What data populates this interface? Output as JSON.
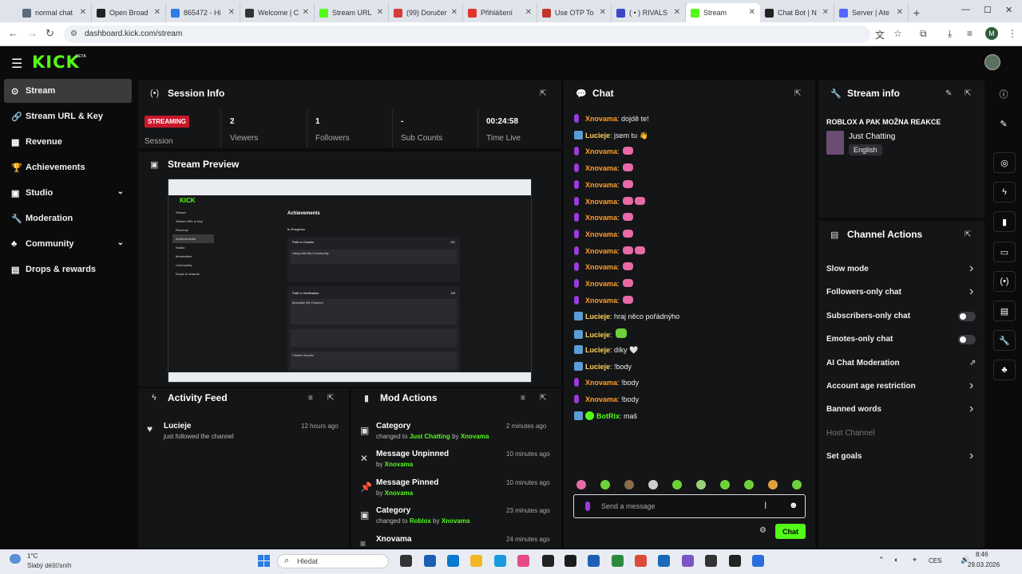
{
  "browser": {
    "tabs": [
      {
        "label": "normal chat",
        "color": "#5b6b7b"
      },
      {
        "label": "Open Broad",
        "color": "#222222"
      },
      {
        "label": "865472 - Hi",
        "color": "#2f7be8"
      },
      {
        "label": "Welcome | C",
        "color": "#333333"
      },
      {
        "label": "Stream URL",
        "color": "#53fc18"
      },
      {
        "label": "(99) Doručer",
        "color": "#d63a3a"
      },
      {
        "label": "Přihlášení",
        "color": "#e0342b"
      },
      {
        "label": "Use OTP To",
        "color": "#c0392b"
      },
      {
        "label": "( • ) RIVALS",
        "color": "#3a48c8"
      },
      {
        "label": "Stream",
        "color": "#53fc18",
        "active": true
      },
      {
        "label": "Chat Bot | N",
        "color": "#222222"
      },
      {
        "label": "Server | Ate",
        "color": "#5468ff"
      }
    ],
    "new_tab": "+",
    "url": "dashboard.kick.com/stream",
    "profile_initial": "M"
  },
  "header": {
    "logo": "KICK",
    "beta": "BETA"
  },
  "sidebar": {
    "items": [
      {
        "label": "Stream",
        "icon": "⊙",
        "active": true
      },
      {
        "label": "Stream URL & Key",
        "icon": "🔗"
      },
      {
        "label": "Revenue",
        "icon": "▦"
      },
      {
        "label": "Achievements",
        "icon": "🏆"
      },
      {
        "label": "Studio",
        "icon": "▣",
        "chevron": "⌄"
      },
      {
        "label": "Moderation",
        "icon": "🔧"
      },
      {
        "label": "Community",
        "icon": "♣",
        "chevron": "⌄"
      },
      {
        "label": "Drops & rewards",
        "icon": "▤"
      }
    ]
  },
  "session": {
    "title": "Session Info",
    "status_badge": "STREAMING",
    "session_label": "Session",
    "stats": [
      {
        "value": "2",
        "label": "Viewers"
      },
      {
        "value": "1",
        "label": "Followers"
      },
      {
        "value": "-",
        "label": "Sub Counts"
      },
      {
        "value": "00:24:58",
        "label": "Time Live"
      }
    ]
  },
  "preview": {
    "title": "Stream Preview",
    "inner_logo": "KICK",
    "inner_heading": "Achievements",
    "inner_section": "In Progress",
    "inner_items": [
      "Path to Creator",
      "Hang with My Community",
      "Path to Verification",
      "Moonlike My Channel",
      "Chatter Boosts"
    ],
    "inner_counts": [
      "0/1",
      "1/5"
    ],
    "inner_menu": [
      "Stream",
      "Stream URL & Key",
      "Revenue",
      "Achievements",
      "Studio",
      "Moderation",
      "Community",
      "Drops & rewards"
    ]
  },
  "activity": {
    "title": "Activity Feed",
    "items": [
      {
        "user": "Lucieje",
        "text": "just followed the channel",
        "time": "12 hours ago"
      }
    ]
  },
  "mod": {
    "title": "Mod Actions",
    "items": [
      {
        "title": "Category",
        "prefix": "changed to ",
        "target": "Just Chatting",
        "by": " by ",
        "user": "Xnovama",
        "time": "2 minutes ago",
        "icon": "▣"
      },
      {
        "title": "Message Unpinned",
        "prefix": "",
        "target": "",
        "by": "by ",
        "user": "Xnovama",
        "time": "10 minutes ago",
        "icon": "✕"
      },
      {
        "title": "Message Pinned",
        "prefix": "",
        "target": "",
        "by": "by ",
        "user": "Xnovama",
        "time": "10 minutes ago",
        "icon": "📌"
      },
      {
        "title": "Category",
        "prefix": "changed to ",
        "target": "Roblox",
        "by": " by ",
        "user": "Xnovama",
        "time": "23 minutes ago",
        "icon": "▣"
      },
      {
        "title": "Xnovama",
        "prefix": "",
        "target": "",
        "by": "",
        "user": "",
        "time": "24 minutes ago",
        "icon": "≡"
      }
    ]
  },
  "chat": {
    "title": "Chat",
    "messages": [
      {
        "user": "Xnovama",
        "color": "#ff9d2e",
        "text": "dojdě te!",
        "emotes": 0
      },
      {
        "user": "Lucieje",
        "color": "#ffd257",
        "text": "jsem tu 👋",
        "emotes": 0
      },
      {
        "user": "Xnovama",
        "color": "#ff9d2e",
        "text": "",
        "emotes": 1
      },
      {
        "user": "Xnovama",
        "color": "#ff9d2e",
        "text": "",
        "emotes": 1
      },
      {
        "user": "Xnovama",
        "color": "#ff9d2e",
        "text": "",
        "emotes": 1
      },
      {
        "user": "Xnovama",
        "color": "#ff9d2e",
        "text": "",
        "emotes": 2
      },
      {
        "user": "Xnovama",
        "color": "#ff9d2e",
        "text": "",
        "emotes": 1
      },
      {
        "user": "Xnovama",
        "color": "#ff9d2e",
        "text": "",
        "emotes": 1
      },
      {
        "user": "Xnovama",
        "color": "#ff9d2e",
        "text": "",
        "emotes": 2
      },
      {
        "user": "Xnovama",
        "color": "#ff9d2e",
        "text": "",
        "emotes": 1
      },
      {
        "user": "Xnovama",
        "color": "#ff9d2e",
        "text": "",
        "emotes": 1
      },
      {
        "user": "Xnovama",
        "color": "#ff9d2e",
        "text": "",
        "emotes": 1
      },
      {
        "user": "Lucieje",
        "color": "#ffd257",
        "text": "hraj něco pořádnýho",
        "emotes": 0
      },
      {
        "user": "Lucieje",
        "color": "#ffd257",
        "text": "",
        "emotes": 1,
        "green": true
      },
      {
        "user": "Lucieje",
        "color": "#ffd257",
        "text": "díky 🤍",
        "emotes": 0
      },
      {
        "user": "Lucieje",
        "color": "#ffd257",
        "text": "!body",
        "emotes": 0
      },
      {
        "user": "Xnovama",
        "color": "#ff9d2e",
        "text": "!body",
        "emotes": 0
      },
      {
        "user": "Xnovama",
        "color": "#ff9d2e",
        "text": "!body",
        "emotes": 0
      },
      {
        "user": "BotRix",
        "color": "#53fc18",
        "text": "maš",
        "emotes": 0
      }
    ],
    "input_placeholder": "Send a message",
    "send_label": "Chat",
    "emote_colors": [
      "#e76aa6",
      "#6fd13a",
      "#8a6d4a",
      "#cccccc",
      "#6fd13a",
      "#9ad17a",
      "#6fd13a",
      "#6fd13a",
      "#e0a040",
      "#6fd13a"
    ]
  },
  "stream_info": {
    "title": "Stream info",
    "stream_title": "ROBLOX A PAK MOŽNA REAKCE",
    "category": "Just Chatting",
    "language": "English"
  },
  "channel_actions": {
    "title": "Channel Actions",
    "items": [
      {
        "label": "Slow mode",
        "control": "chevron"
      },
      {
        "label": "Followers-only chat",
        "control": "chevron"
      },
      {
        "label": "Subscribers-only chat",
        "control": "toggle"
      },
      {
        "label": "Emotes-only chat",
        "control": "toggle"
      },
      {
        "label": "AI Chat Moderation",
        "control": "external"
      },
      {
        "label": "Account age restriction",
        "control": "chevron"
      },
      {
        "label": "Banned words",
        "control": "chevron"
      },
      {
        "label": "Host Channel",
        "control": "none",
        "disabled": true
      },
      {
        "label": "Set goals",
        "control": "chevron"
      }
    ]
  },
  "taskbar": {
    "weather": "1°C",
    "weather_desc": "Slabý déšť/sníh",
    "search_placeholder": "Hledat",
    "lang": "CES",
    "time": "8:46",
    "date": "29.03.2026"
  }
}
